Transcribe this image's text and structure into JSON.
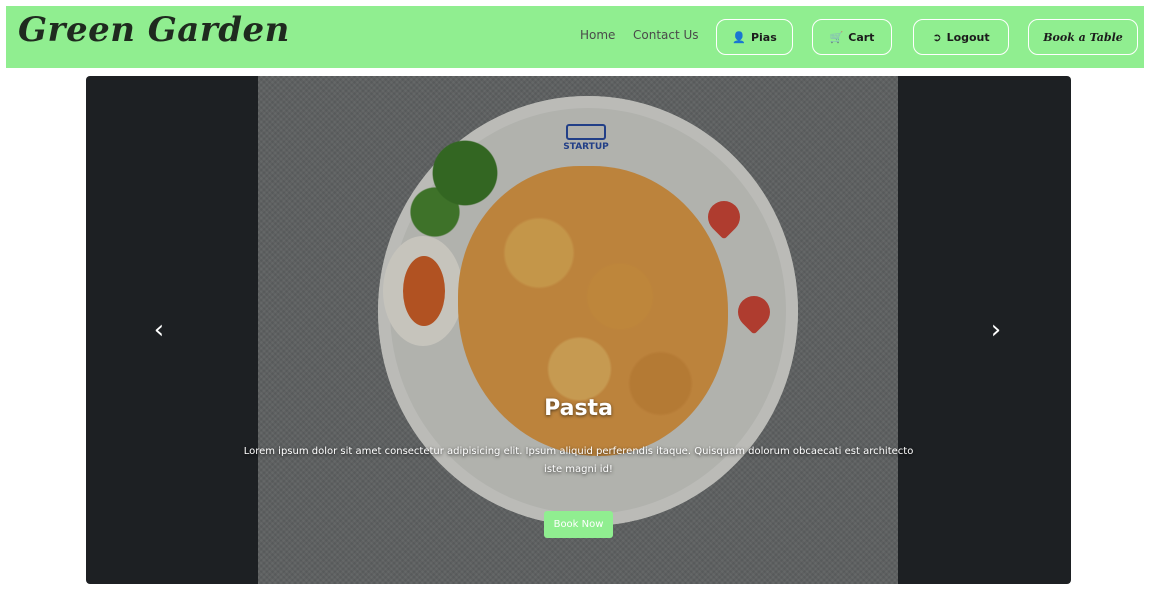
{
  "navbar": {
    "brand": "Green Garden",
    "links": [
      {
        "label": "Home"
      },
      {
        "label": "Contact Us"
      }
    ],
    "buttons": {
      "profile": {
        "label": "Pias",
        "icon": "user-icon"
      },
      "cart": {
        "label": "Cart",
        "icon": "cart-icon"
      },
      "logout": {
        "label": "Logout",
        "icon": "logout-icon"
      },
      "book_table": {
        "label": "Book a Table"
      }
    },
    "background": "#90ee90"
  },
  "carousel": {
    "slide": {
      "title": "Pasta",
      "description": "Lorem ipsum dolor sit amet consectetur adipisicing elit. Ipsum aliquid perferendis itaque. Quisquam dolorum obcaecati est architecto iste magni id!",
      "button": "Book Now",
      "logo_text": "STARTUP"
    },
    "prev_icon": "chevron-left-icon",
    "next_icon": "chevron-right-icon"
  }
}
